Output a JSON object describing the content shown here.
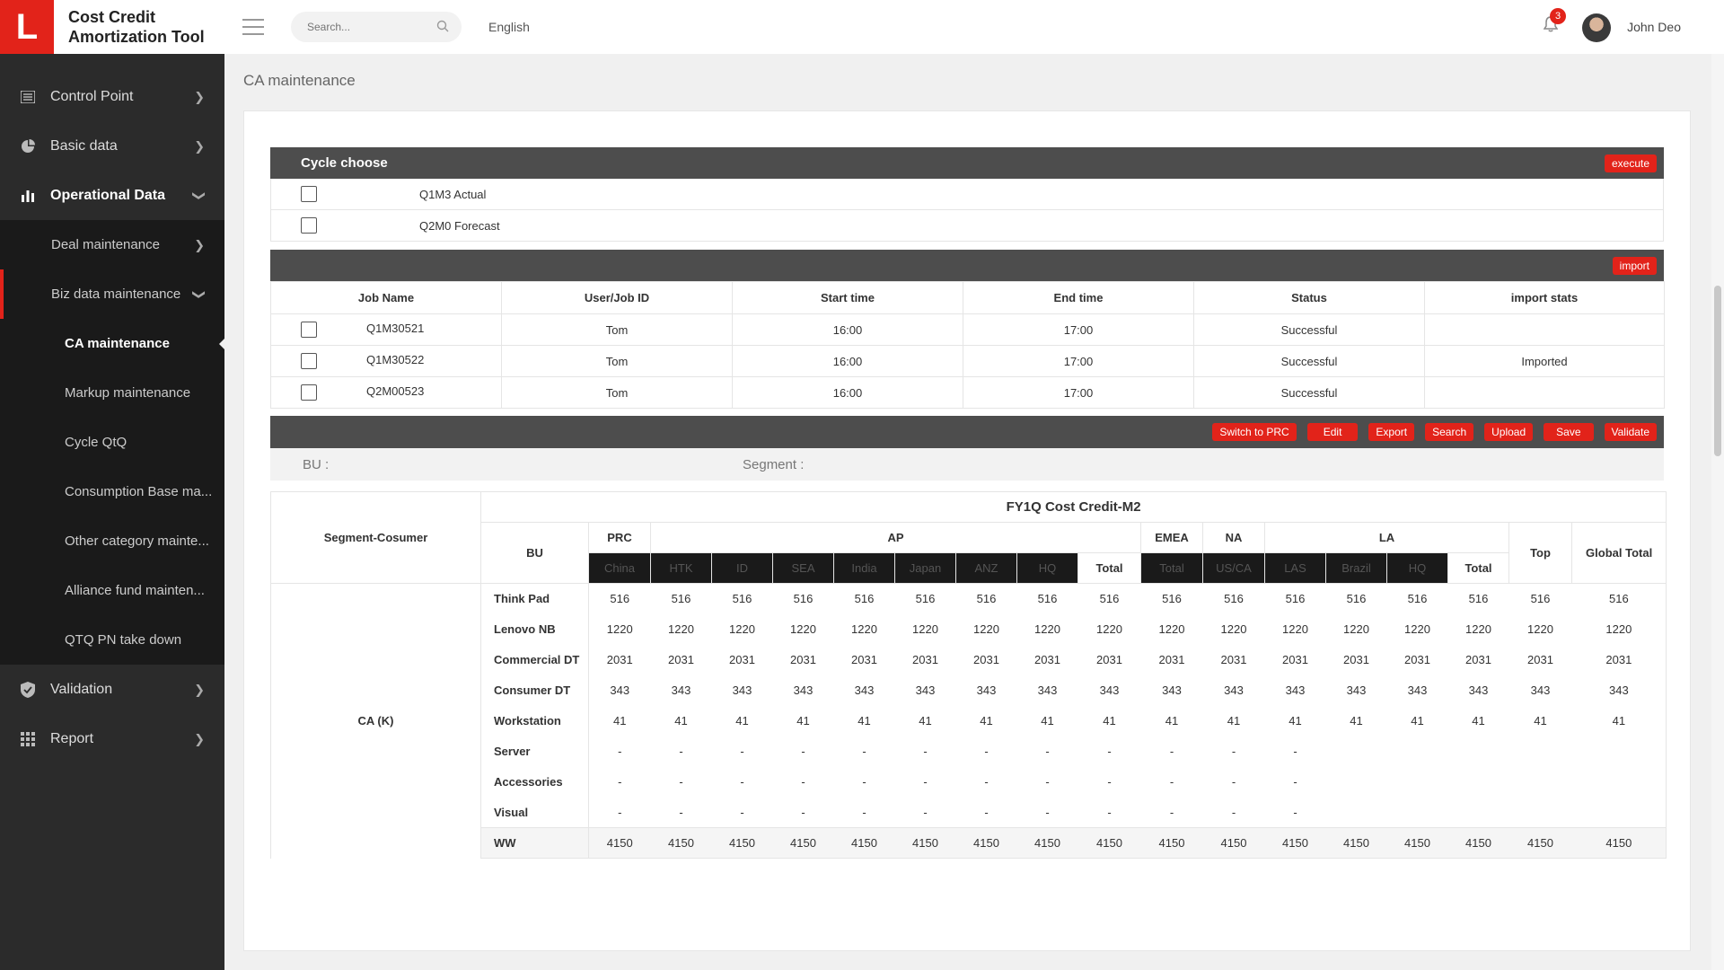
{
  "brand": {
    "logo": "L",
    "title_line1": "Cost Credit",
    "title_line2": "Amortization Tool"
  },
  "topbar": {
    "search_placeholder": "Search...",
    "language": "English",
    "notifications": "3",
    "user": "John Deo"
  },
  "sidebar": {
    "items": [
      {
        "label": "Control Point",
        "icon": "list-icon"
      },
      {
        "label": "Basic data",
        "icon": "pie-icon"
      },
      {
        "label": "Operational Data",
        "icon": "bar-chart-icon"
      }
    ],
    "operational_sub": [
      {
        "label": "Deal maintenance"
      },
      {
        "label": "Biz data maintenance"
      }
    ],
    "biz_sub": [
      {
        "label": "CA maintenance"
      },
      {
        "label": "Markup maintenance"
      },
      {
        "label": "Cycle QtQ"
      },
      {
        "label": "Consumption Base ma..."
      },
      {
        "label": "Other category mainte..."
      },
      {
        "label": "Alliance fund mainten..."
      },
      {
        "label": "QTQ PN take down"
      }
    ],
    "after": [
      {
        "label": "Validation",
        "icon": "shield-icon"
      },
      {
        "label": "Report",
        "icon": "grid-icon"
      }
    ]
  },
  "page": {
    "title": "CA maintenance"
  },
  "cycle": {
    "title": "Cycle choose",
    "execute_label": "execute",
    "options": [
      "Q1M3 Actual",
      "Q2M0 Forecast"
    ]
  },
  "jobs": {
    "import_label": "import",
    "headers": [
      "Job Name",
      "User/Job ID",
      "Start time",
      "End time",
      "Status",
      "import stats"
    ],
    "rows": [
      {
        "name": "Q1M30521",
        "user": "Tom",
        "start": "16:00",
        "end": "17:00",
        "status": "Successful",
        "stats": ""
      },
      {
        "name": "Q1M30522",
        "user": "Tom",
        "start": "16:00",
        "end": "17:00",
        "status": "Successful",
        "stats": "Imported"
      },
      {
        "name": "Q2M00523",
        "user": "Tom",
        "start": "16:00",
        "end": "17:00",
        "status": "Successful",
        "stats": ""
      }
    ]
  },
  "toolbar": [
    "Switch to PRC",
    "Edit",
    "Export",
    "Search",
    "Upload",
    "Save",
    "Validate"
  ],
  "filter": {
    "bu_label": "BU :",
    "segment_label": "Segment :"
  },
  "grid": {
    "segment_header": "Segment-Cosumer",
    "title": "FY1Q Cost Credit-M2",
    "bu_header": "BU",
    "groups": {
      "prc": "PRC",
      "ap": "AP",
      "emea": "EMEA",
      "na": "NA",
      "la": "LA",
      "top": "Top",
      "global": "Global Total"
    },
    "subcols": [
      "China",
      "HTK",
      "ID",
      "SEA",
      "India",
      "Japan",
      "ANZ",
      "HQ",
      "Total",
      "Total",
      "US/CA",
      "LAS",
      "Brazil",
      "HQ",
      "Total"
    ],
    "segment_value": "CA (K)",
    "rows": [
      {
        "label": "Think Pad",
        "values": [
          "516",
          "516",
          "516",
          "516",
          "516",
          "516",
          "516",
          "516",
          "516",
          "516",
          "516",
          "516",
          "516",
          "516",
          "516",
          "516",
          "516"
        ]
      },
      {
        "label": "Lenovo NB",
        "values": [
          "1220",
          "1220",
          "1220",
          "1220",
          "1220",
          "1220",
          "1220",
          "1220",
          "1220",
          "1220",
          "1220",
          "1220",
          "1220",
          "1220",
          "1220",
          "1220",
          "1220"
        ]
      },
      {
        "label": "Commercial DT",
        "values": [
          "2031",
          "2031",
          "2031",
          "2031",
          "2031",
          "2031",
          "2031",
          "2031",
          "2031",
          "2031",
          "2031",
          "2031",
          "2031",
          "2031",
          "2031",
          "2031",
          "2031"
        ]
      },
      {
        "label": "Consumer DT",
        "values": [
          "343",
          "343",
          "343",
          "343",
          "343",
          "343",
          "343",
          "343",
          "343",
          "343",
          "343",
          "343",
          "343",
          "343",
          "343",
          "343",
          "343"
        ]
      },
      {
        "label": "Workstation",
        "values": [
          "41",
          "41",
          "41",
          "41",
          "41",
          "41",
          "41",
          "41",
          "41",
          "41",
          "41",
          "41",
          "41",
          "41",
          "41",
          "41",
          "41"
        ]
      },
      {
        "label": "Server",
        "values": [
          "-",
          "-",
          "-",
          "-",
          "-",
          "-",
          "-",
          "-",
          "-",
          "-",
          "-",
          "-",
          "",
          "",
          "",
          "",
          ""
        ]
      },
      {
        "label": "Accessories",
        "values": [
          "-",
          "-",
          "-",
          "-",
          "-",
          "-",
          "-",
          "-",
          "-",
          "-",
          "-",
          "-",
          "",
          "",
          "",
          "",
          ""
        ]
      },
      {
        "label": "Visual",
        "values": [
          "-",
          "-",
          "-",
          "-",
          "-",
          "-",
          "-",
          "-",
          "-",
          "-",
          "-",
          "-",
          "",
          "",
          "",
          "",
          ""
        ]
      },
      {
        "label": "WW",
        "values": [
          "4150",
          "4150",
          "4150",
          "4150",
          "4150",
          "4150",
          "4150",
          "4150",
          "4150",
          "4150",
          "4150",
          "4150",
          "4150",
          "4150",
          "4150",
          "4150",
          "4150"
        ]
      }
    ]
  }
}
